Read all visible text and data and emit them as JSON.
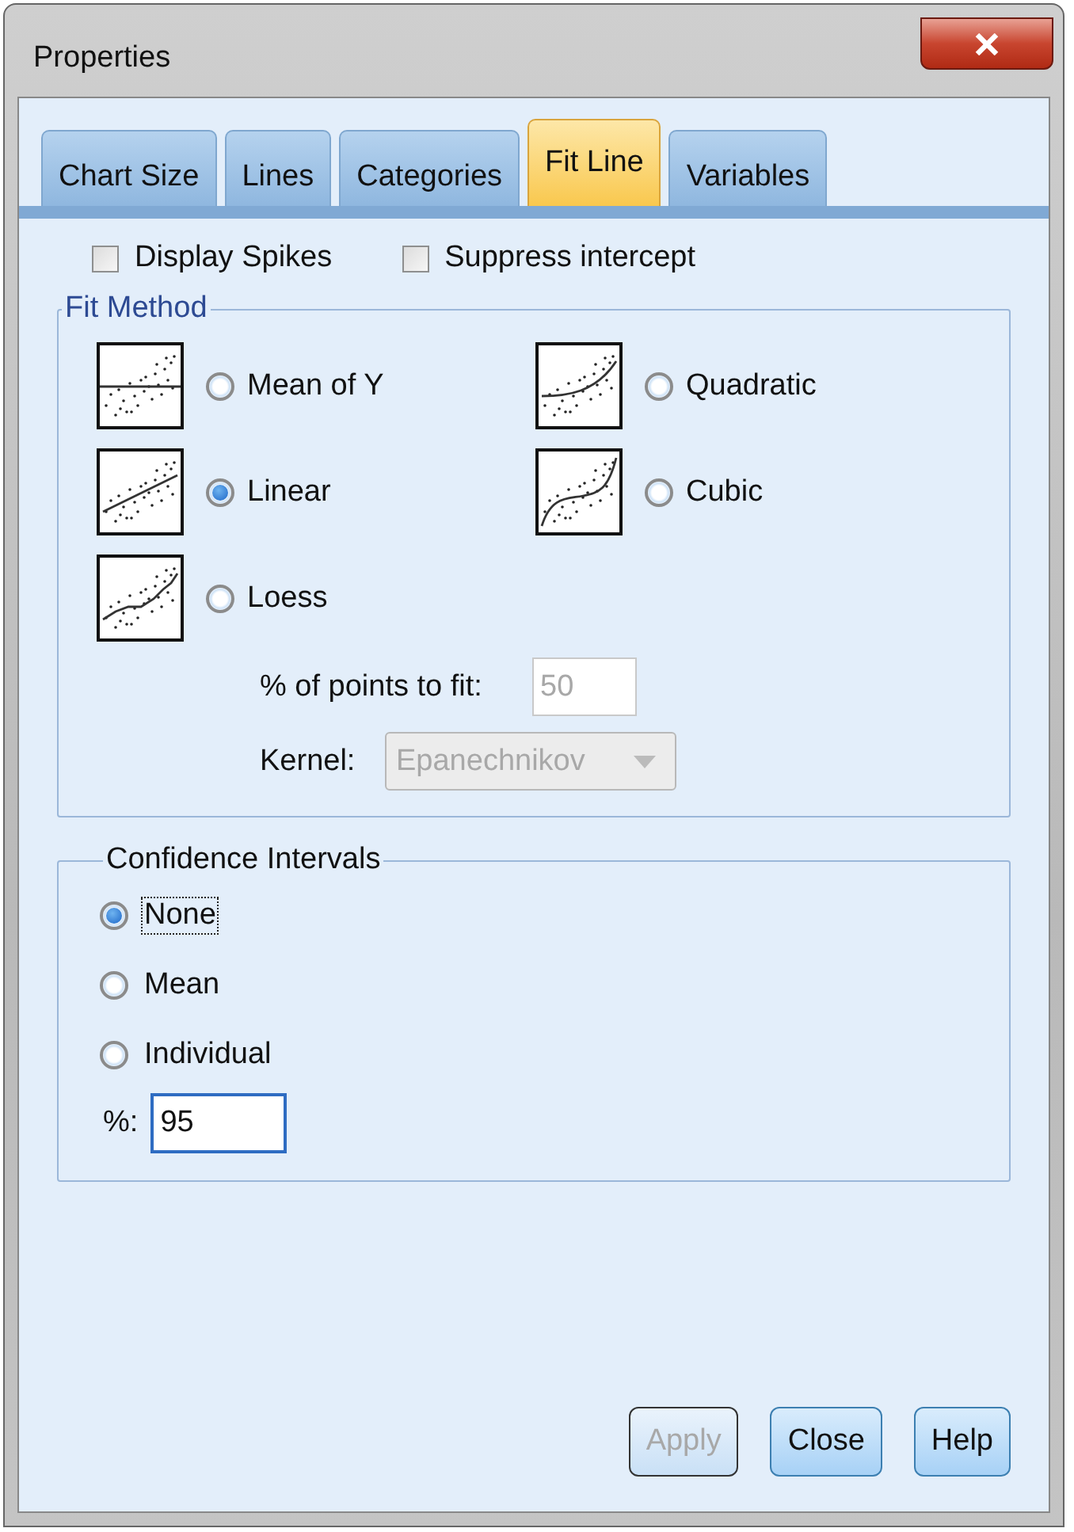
{
  "window": {
    "title": "Properties"
  },
  "tabs": [
    {
      "label": "Chart Size",
      "selected": false
    },
    {
      "label": "Lines",
      "selected": false
    },
    {
      "label": "Categories",
      "selected": false
    },
    {
      "label": "Fit Line",
      "selected": true
    },
    {
      "label": "Variables",
      "selected": false
    }
  ],
  "options": [
    {
      "label": "Display Spikes",
      "checked": false
    },
    {
      "label": "Suppress intercept",
      "checked": false
    }
  ],
  "fit_method": {
    "title": "Fit Method",
    "methods": [
      {
        "label": "Mean of Y",
        "kind": "mean",
        "selected": false
      },
      {
        "label": "Quadratic",
        "kind": "quadratic",
        "selected": false
      },
      {
        "label": "Linear",
        "kind": "linear",
        "selected": true
      },
      {
        "label": "Cubic",
        "kind": "cubic",
        "selected": false
      },
      {
        "label": "Loess",
        "kind": "loess",
        "selected": false
      }
    ],
    "points_to_fit": {
      "label": "% of points to fit:",
      "value": "50",
      "disabled": true
    },
    "kernel": {
      "label": "Kernel:",
      "value": "Epanechnikov",
      "disabled": true
    }
  },
  "confidence_intervals": {
    "title": "Confidence Intervals",
    "options": [
      {
        "label": "None",
        "selected": true,
        "focused": true
      },
      {
        "label": "Mean",
        "selected": false,
        "focused": false
      },
      {
        "label": "Individual",
        "selected": false,
        "focused": false
      }
    ],
    "percent": {
      "label": "%:",
      "value": "95"
    }
  },
  "buttons": [
    {
      "label": "Apply",
      "disabled": true
    },
    {
      "label": "Close",
      "disabled": false
    },
    {
      "label": "Help",
      "disabled": false
    }
  ]
}
